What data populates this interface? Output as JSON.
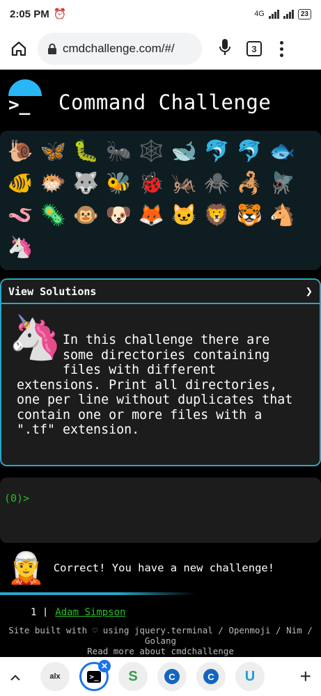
{
  "status_bar": {
    "time": "2:05 PM",
    "network": "4G",
    "battery": "23"
  },
  "browser": {
    "url": "cmdchallenge.com/#/",
    "tab_count": "3"
  },
  "header": {
    "logo": ">_",
    "title": "Command Challenge"
  },
  "emoji_grid": [
    "🐌",
    "🦋",
    "🐛",
    "🐜",
    "🕸️",
    "🐋",
    "🐬",
    "🐬",
    "🐟",
    "🐠",
    "🐡",
    "🐺",
    "🐝",
    "🐞",
    "🦗",
    "🕷️",
    "🦂",
    "🪰",
    "🪱",
    "🦠",
    "🐵",
    "🐶",
    "🦊",
    "🐱",
    "🦁",
    "🐯",
    "🐴",
    "🦄"
  ],
  "challenge": {
    "header": "View Solutions",
    "chevron": "❯",
    "avatar": "🦄",
    "description": "      In this challenge there are\n      some directories containing\n      files with different\nextensions. Print all directories,\none per line without duplicates that\ncontain one or more files with a\n\".tf\" extension."
  },
  "terminal": {
    "prompt": "(0)>"
  },
  "feedback": {
    "avatar": "🧝",
    "message": "Correct! You have a new challenge!"
  },
  "leaderboard": {
    "rank": "1 |",
    "name": "Adam Simpson"
  },
  "footer": {
    "line1": "Site built with ♡ using jquery.terminal / Openmoji / Nim /",
    "line2": "Golang",
    "line3": "Read more about cmdchallenge"
  },
  "tab_strip": {
    "tabs": [
      {
        "label": "alx"
      },
      {
        "label": ">_",
        "active": true
      },
      {
        "label": "S"
      },
      {
        "label": "C"
      },
      {
        "label": "C"
      },
      {
        "label": "U"
      }
    ]
  },
  "colors": {
    "accent": "#29a7c9",
    "prompt": "#22c022",
    "tab_active": "#1a73e8"
  }
}
